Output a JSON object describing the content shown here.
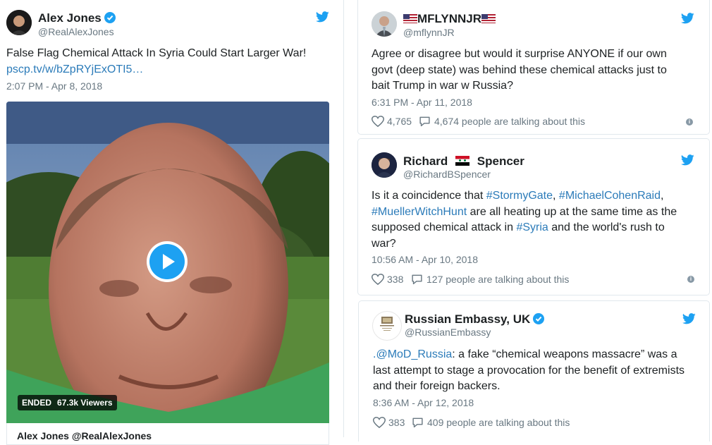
{
  "tweets": [
    {
      "name": "Alex Jones",
      "handle": "@RealAlexJones",
      "verified": true,
      "text": "False Flag Chemical Attack In Syria Could Start Larger War!",
      "link": "pscp.tv/w/bZpRYjExOTI5…",
      "time": "2:07 PM - Apr 8, 2018",
      "video": {
        "status": "ENDED",
        "viewers": "67.3k Viewers"
      },
      "card_footer": "Alex Jones @RealAlexJones"
    },
    {
      "name_left_flag": "🇺🇸",
      "name": "MFLYNNJR",
      "name_right_flag": "🇺🇸",
      "handle": "@mflynnJR",
      "text": "Agree or disagree but would it surprise ANYONE if our own govt (deep state) was behind these chemical attacks just to bait Trump in war w Russia?",
      "time": "6:31 PM - Apr 11, 2018",
      "likes": "4,765",
      "talking": "4,674 people are talking about this"
    },
    {
      "name_first": "Richard",
      "name_last": "Spencer",
      "handle": "@RichardBSpencer",
      "text_parts": [
        {
          "t": "Is it a coincidence that ",
          "link": false
        },
        {
          "t": "#StormyGate",
          "link": true
        },
        {
          "t": ", ",
          "link": false
        },
        {
          "t": "#MichaelCohenRaid",
          "link": true
        },
        {
          "t": ", ",
          "link": false
        },
        {
          "t": "#MuellerWitchHunt",
          "link": true
        },
        {
          "t": " are all heating up at the same time as the supposed chemical attack in ",
          "link": false
        },
        {
          "t": "#Syria",
          "link": true
        },
        {
          "t": " and the world's rush to war?",
          "link": false
        }
      ],
      "time": "10:56 AM - Apr 10, 2018",
      "likes": "338",
      "talking": "127 people are talking about this"
    },
    {
      "name": "Russian Embassy, UK",
      "handle": "@RussianEmbassy",
      "verified": true,
      "text_parts": [
        {
          "t": ".@MoD_Russia",
          "link": true
        },
        {
          "t": ": a fake “chemical weapons massacre” was a last attempt to stage a provocation for the benefit of extremists and their foreign backers.",
          "link": false
        }
      ],
      "time": "8:36 AM - Apr 12, 2018",
      "likes": "383",
      "talking": "409 people are talking about this"
    }
  ],
  "colors": {
    "link": "#2b7bb9",
    "twitter_blue": "#1da1f2",
    "meta": "#697882"
  }
}
